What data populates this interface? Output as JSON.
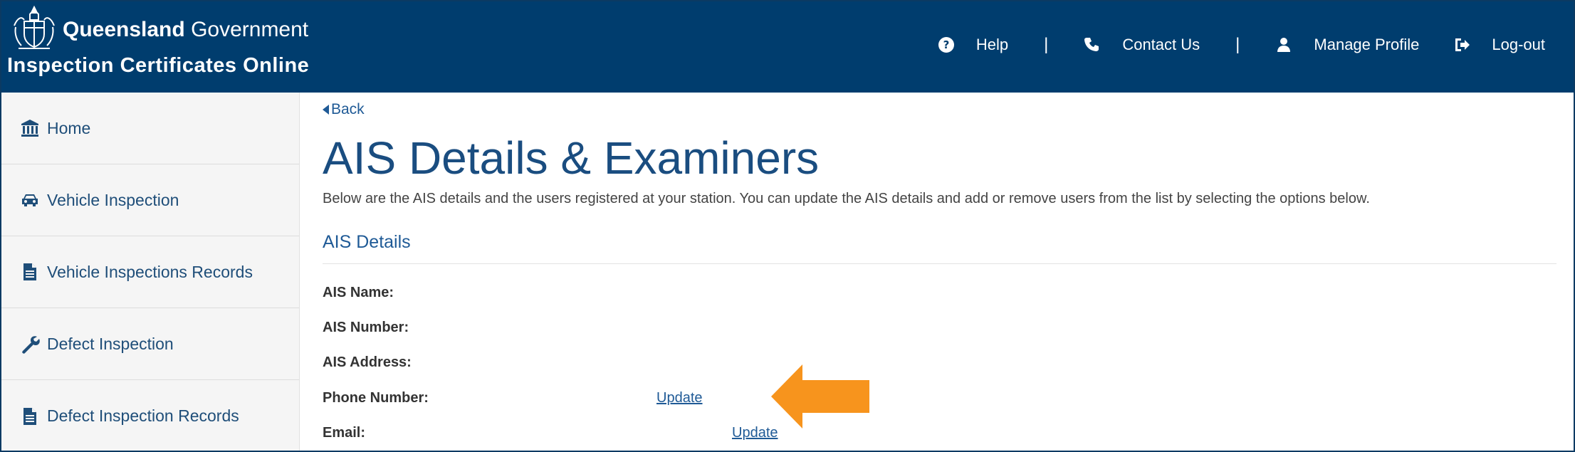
{
  "header": {
    "gov_name_bold": "Queensland",
    "gov_name_rest": "Government",
    "app_name": "Inspection Certificates Online",
    "nav": {
      "help": "Help",
      "contact": "Contact Us",
      "profile": "Manage Profile",
      "logout": "Log-out",
      "separator": "|"
    },
    "colors": {
      "bar": "#003d6e"
    }
  },
  "sidebar": {
    "items": [
      {
        "label": "Home",
        "icon": "bank-icon"
      },
      {
        "label": "Vehicle Inspection",
        "icon": "car-icon"
      },
      {
        "label": "Vehicle Inspections Records",
        "icon": "document-icon"
      },
      {
        "label": "Defect Inspection",
        "icon": "wrench-icon"
      },
      {
        "label": "Defect Inspection Records",
        "icon": "document-icon"
      }
    ]
  },
  "main": {
    "back_label": "Back",
    "title": "AIS Details & Examiners",
    "intro": "Below are the AIS details and the users registered at your station. You can update the AIS details and add or remove users from the list by selecting the options below.",
    "section_title": "AIS Details",
    "fields": [
      {
        "label": "AIS Name:"
      },
      {
        "label": "AIS Number:"
      },
      {
        "label": "AIS Address:"
      },
      {
        "label": "Phone Number:",
        "action": "Update"
      },
      {
        "label": "Email:",
        "action": "Update"
      }
    ]
  },
  "annotation": {
    "arrow_color": "#f7941d"
  }
}
